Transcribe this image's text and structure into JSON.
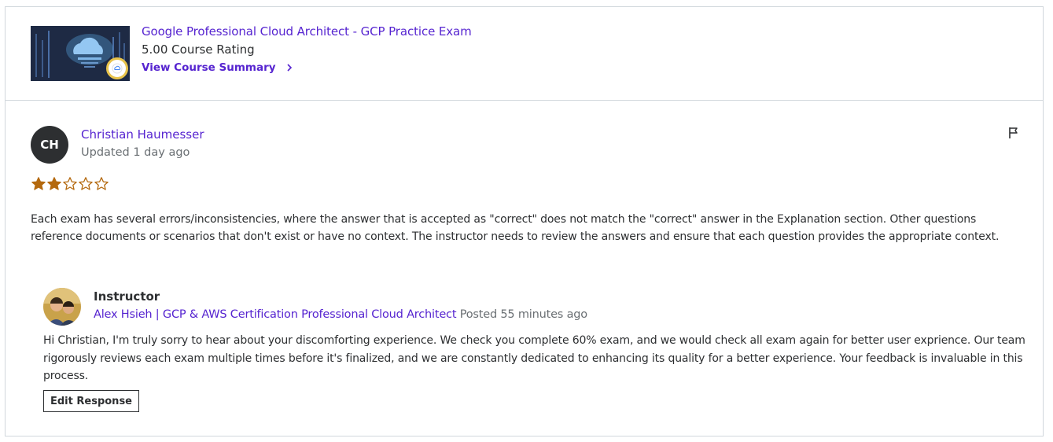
{
  "course": {
    "title": "Google Professional Cloud Architect - GCP Practice Exam",
    "rating": "5.00 Course Rating",
    "summary_link": "View Course Summary",
    "thumbnail_icon": "cloud-image",
    "chevron_icon": "chevron-right-icon"
  },
  "review": {
    "avatar_initials": "CH",
    "reviewer_name": "Christian Haumesser",
    "updated": "Updated 1 day ago",
    "rating": 2,
    "rating_max": 5,
    "flag_icon": "flag-icon",
    "text": "Each exam has several errors/inconsistencies, where the answer that is accepted as \"correct\" does not match the \"correct\" answer in the Explanation section. Other questions reference documents or scenarios that don't exist or have no context. The instructor needs to review the answers and ensure that each question provides the appropriate context."
  },
  "response": {
    "role": "Instructor",
    "instructor_name": "Alex Hsieh | GCP & AWS Certification Professional Cloud Architect",
    "posted": "Posted 55 minutes ago",
    "text": "Hi Christian, I'm truly sorry to hear about your discomforting experience. We check you complete 60% exam, and we would check all exam again for better user exprience. Our team rigorously reviews each exam multiple times before it's finalized, and we are constantly dedicated to enhancing its quality for a better experience. Your feedback is invaluable in this process.",
    "edit_button": "Edit Response"
  },
  "colors": {
    "link": "#5624d0",
    "star": "#b4690e",
    "text": "#2d2f31",
    "muted": "#6a6f73",
    "border": "#d1d7dc"
  }
}
